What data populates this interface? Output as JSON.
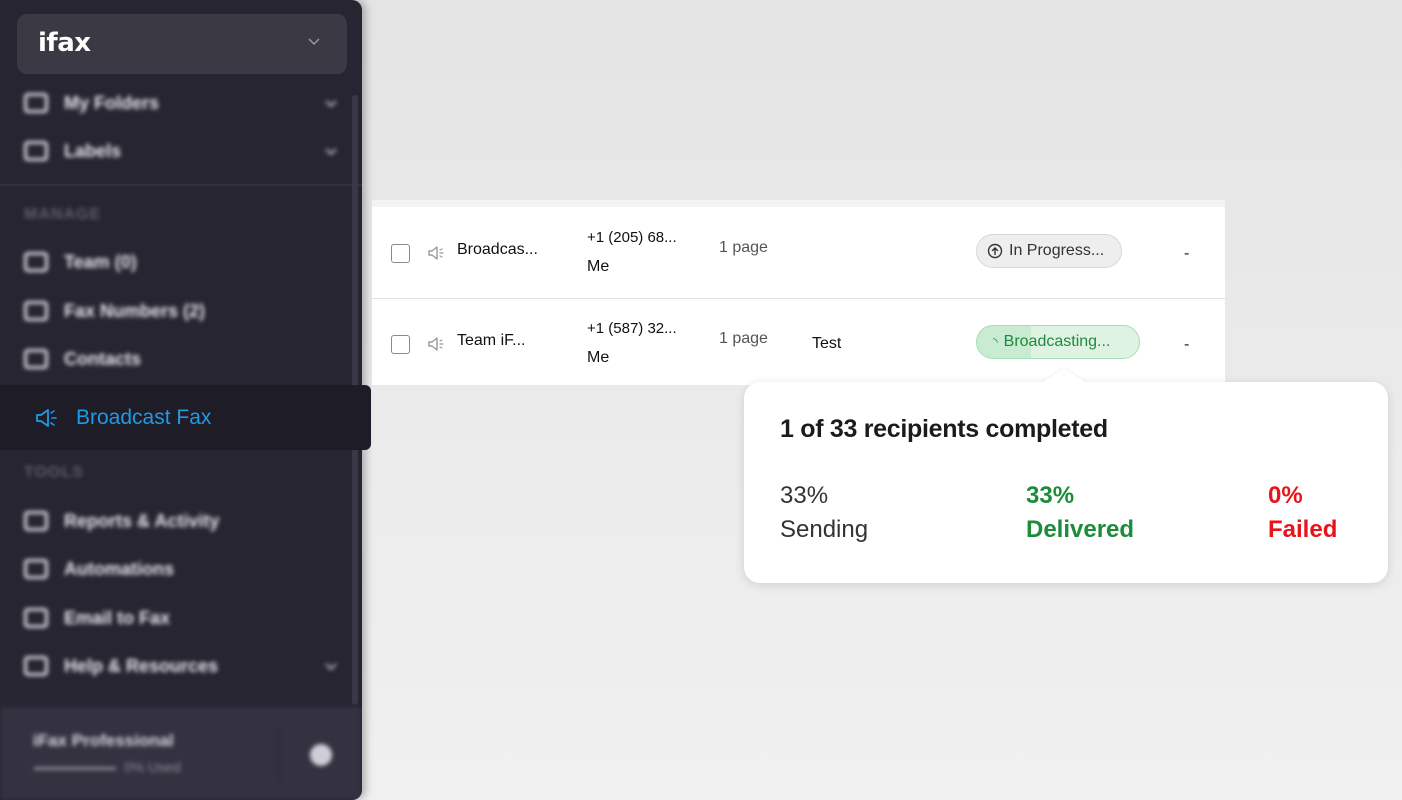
{
  "app": {
    "logo": "ifax"
  },
  "sidebar": {
    "items": [
      {
        "label": "My Folders"
      },
      {
        "label": "Labels"
      }
    ],
    "manage_header": "MANAGE",
    "manage_items": [
      {
        "label": "Team (0)"
      },
      {
        "label": "Fax Numbers (2)"
      },
      {
        "label": "Contacts"
      }
    ],
    "active_item": {
      "label": "Broadcast Fax",
      "icon": "megaphone-icon",
      "color": "#1f9be3"
    },
    "tools_header": "TOOLS",
    "tools_items": [
      {
        "label": "Reports & Activity"
      },
      {
        "label": "Automations"
      },
      {
        "label": "Email to Fax"
      },
      {
        "label": "Help & Resources"
      }
    ],
    "plan": {
      "name": "iFax Professional",
      "usage": "0% Used"
    }
  },
  "table": {
    "rows": [
      {
        "name": "Broadcas...",
        "number": "+1 (205) 68...",
        "sender": "Me",
        "pages": "1 page",
        "subject": "",
        "status": "In Progress...",
        "extra": "-"
      },
      {
        "name": "Team iF...",
        "number": "+1 (587) 32...",
        "sender": "Me",
        "pages": "1 page",
        "subject": "Test",
        "status": "Broadcasting...",
        "extra": "-"
      }
    ]
  },
  "popover": {
    "title": "1 of 33 recipients completed",
    "stats": [
      {
        "percent": "33%",
        "label": "Sending",
        "color": "#333333"
      },
      {
        "percent": "33%",
        "label": "Delivered",
        "color": "#1d8c3a"
      },
      {
        "percent": "0%",
        "label": "Failed",
        "color": "#e8141c"
      }
    ]
  }
}
